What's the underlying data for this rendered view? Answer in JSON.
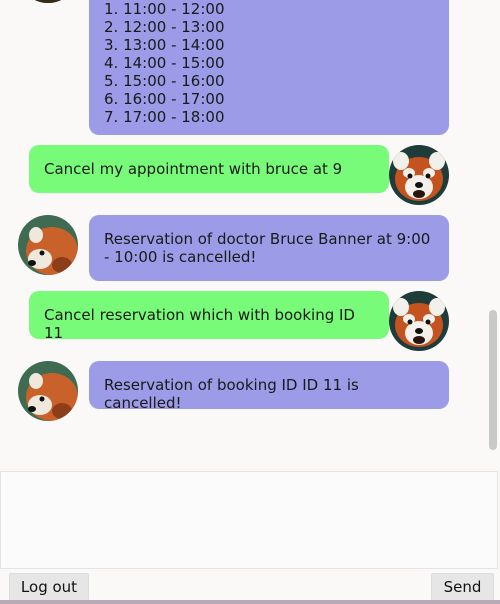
{
  "messages": {
    "slots": {
      "items": [
        "1. 11:00 - 12:00",
        "2. 12:00 - 13:00",
        "3. 13:00 - 14:00",
        "4. 14:00 - 15:00",
        "5. 15:00 - 16:00",
        "6. 16:00 - 17:00",
        "7. 17:00 - 18:00"
      ]
    },
    "user_cancel_bruce": "Cancel my appointment with bruce at 9",
    "bot_cancel_bruce": "Reservation of doctor Bruce Banner at 9:00 - 10:00 is cancelled!",
    "user_cancel_id": "Cancel reservation which with booking ID 11",
    "bot_cancel_id": "Reservation of booking ID ID 11 is cancelled!"
  },
  "input": {
    "placeholder": "",
    "value": ""
  },
  "buttons": {
    "logout_label": "Log out",
    "send_label": "Send"
  },
  "colors": {
    "bot_bubble": "#9b9be8",
    "user_bubble": "#78fb78",
    "background": "#faf9f7"
  },
  "icons": {
    "bot_avatar": "red-panda-avatar-icon",
    "user_avatar": "red-panda-face-avatar-icon"
  }
}
